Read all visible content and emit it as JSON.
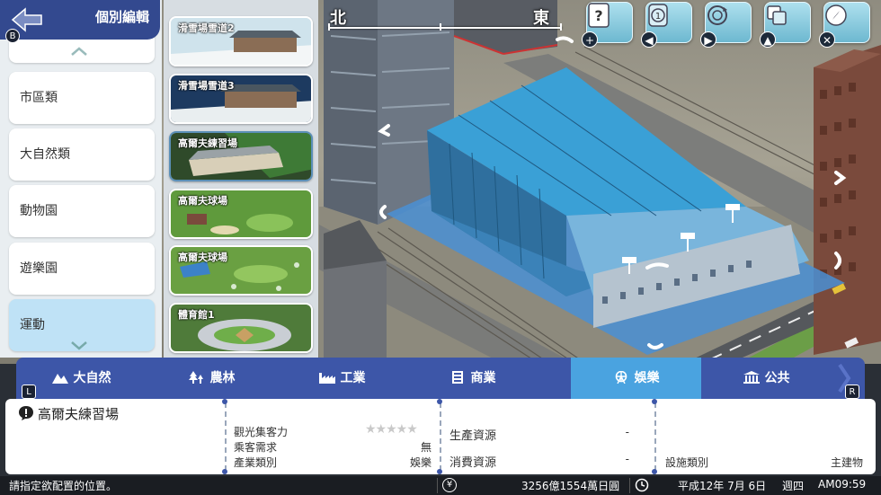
{
  "compass": {
    "left": "北",
    "right": "東"
  },
  "toolbar": [
    {
      "name": "help",
      "badge": "+"
    },
    {
      "name": "layer-1",
      "badge": "◀"
    },
    {
      "name": "rotate",
      "badge": "▶"
    },
    {
      "name": "layers",
      "badge": "▲"
    },
    {
      "name": "compass",
      "badge": "✕"
    }
  ],
  "header": {
    "title": "個別編輯",
    "back_badge": "B"
  },
  "categories": [
    {
      "label": "市區類"
    },
    {
      "label": "大自然類"
    },
    {
      "label": "動物園"
    },
    {
      "label": "遊樂園"
    },
    {
      "label": "運動"
    }
  ],
  "thumbnails": [
    {
      "label": "滑雪場雪道2"
    },
    {
      "label": "滑雪場雪道3"
    },
    {
      "label": "高爾夫練習場"
    },
    {
      "label": "高爾夫球場"
    },
    {
      "label": "高爾夫球場"
    },
    {
      "label": "體育館1"
    }
  ],
  "tabs": [
    {
      "label": "大自然"
    },
    {
      "label": "農林"
    },
    {
      "label": "工業"
    },
    {
      "label": "商業"
    },
    {
      "label": "娛樂"
    },
    {
      "label": "公共"
    }
  ],
  "tab_badges": {
    "left": "L",
    "right": "R"
  },
  "info": {
    "title": "高爾夫練習場",
    "tourism_label": "觀光集客力",
    "passenger_label": "乘客需求",
    "passenger_value": "無",
    "industry_label": "產業類別",
    "industry_value": "娛樂",
    "produce_label": "生產資源",
    "produce_value": "-",
    "consume_label": "消費資源",
    "consume_value": "-",
    "facility_label": "設施類別",
    "facility_value": "主建物"
  },
  "status": {
    "message": "請指定欲配置的位置。",
    "money": "3256億1554萬日圓",
    "date": "平成12年 7月 6日",
    "weekday": "週四",
    "time": "AM09:59"
  },
  "colors": {
    "accent": "#3d56a8",
    "active_tab": "#4aa3e0",
    "building": "#3aa0d6"
  }
}
